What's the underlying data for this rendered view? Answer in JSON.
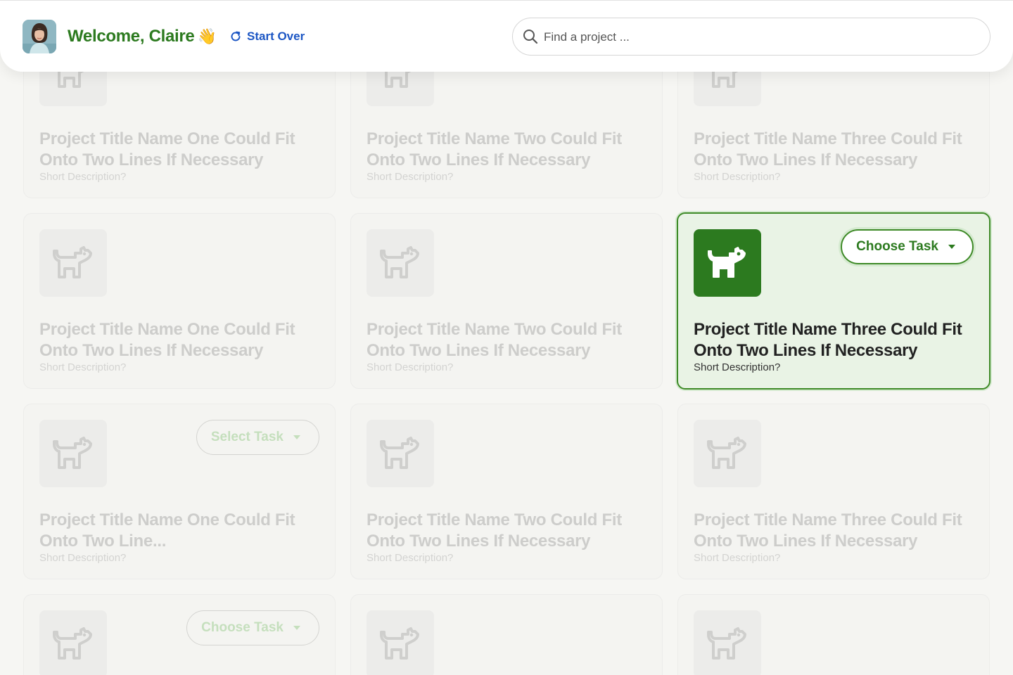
{
  "header": {
    "greeting": "Welcome, Claire",
    "wave_emoji": "👋",
    "start_over_label": "Start Over",
    "search_placeholder": "Find a project ..."
  },
  "icons": {
    "avatar": "user-avatar",
    "start_over": "refresh-icon",
    "search": "search-icon",
    "project": "dog-icon",
    "dropdown": "caret-down-icon"
  },
  "colors": {
    "brand_green": "#2c7a1f",
    "link_blue": "#1c56c4",
    "active_card_bg": "#e9f3e5",
    "page_bg": "#f6f6f3"
  },
  "cards": [
    {
      "title": "Project Title Name One Could Fit Onto Two Lines If Necessary",
      "desc": "Short Description?",
      "state": "disabled"
    },
    {
      "title": "Project Title Name Two Could Fit Onto Two Lines If Necessary",
      "desc": "Short Description?",
      "state": "disabled"
    },
    {
      "title": "Project Title Name Three Could Fit Onto Two Lines If Necessary",
      "desc": "Short Description?",
      "state": "disabled"
    },
    {
      "title": "Project Title Name One Could Fit Onto Two Lines If Necessary",
      "desc": "Short Description?",
      "state": "disabled"
    },
    {
      "title": "Project Title Name Two Could Fit Onto Two Lines If Necessary",
      "desc": "Short Description?",
      "state": "disabled"
    },
    {
      "title": "Project Title Name Three Could Fit Onto Two Lines If Necessary",
      "desc": "Short Description?",
      "state": "active",
      "task_label": "Choose Task"
    },
    {
      "title": "Project Title Name One Could Fit Onto Two Line...",
      "desc": "Short Description?",
      "state": "disabled",
      "task_label": "Select Task"
    },
    {
      "title": "Project Title Name Two Could Fit Onto Two Lines If Necessary",
      "desc": "Short Description?",
      "state": "disabled"
    },
    {
      "title": "Project Title Name Three Could Fit Onto Two Lines If Necessary",
      "desc": "Short Description?",
      "state": "disabled"
    },
    {
      "title": "",
      "desc": "",
      "state": "disabled",
      "task_label": "Choose Task"
    },
    {
      "title": "",
      "desc": "",
      "state": "disabled"
    },
    {
      "title": "",
      "desc": "",
      "state": "disabled"
    }
  ]
}
